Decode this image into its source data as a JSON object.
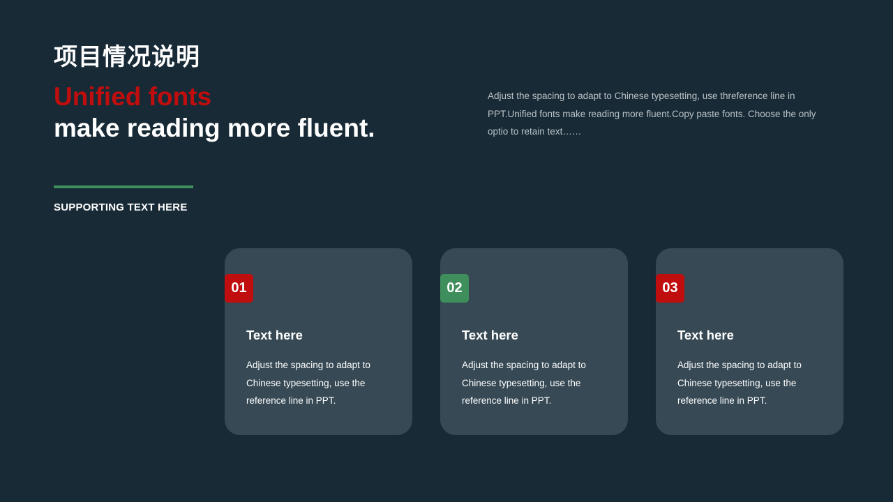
{
  "header": {
    "cn_title": "项目情况说明",
    "headline_accent": "Unified fonts",
    "headline_main": "make reading more fluent.",
    "description": "Adjust the spacing to adapt to Chinese typesetting, use threference line in PPT.Unified fonts make reading more fluent.Copy paste fonts. Choose the only optio to retain text……"
  },
  "supporting_text": "SUPPORTING TEXT HERE",
  "colors": {
    "background": "#182a35",
    "card": "#364954",
    "accent_red": "#c00d0d",
    "accent_green": "#3f8f5c"
  },
  "cards": [
    {
      "number": "01",
      "badge_color": "#c00d0d",
      "title": "Text here",
      "body": "Adjust the spacing to adapt to Chinese typesetting, use the reference line in PPT."
    },
    {
      "number": "02",
      "badge_color": "#3f8f5c",
      "title": "Text here",
      "body": "Adjust the spacing to adapt to Chinese typesetting, use the reference line in PPT."
    },
    {
      "number": "03",
      "badge_color": "#c00d0d",
      "title": "Text here",
      "body": "Adjust the spacing to adapt to Chinese typesetting, use the reference line in PPT."
    }
  ]
}
